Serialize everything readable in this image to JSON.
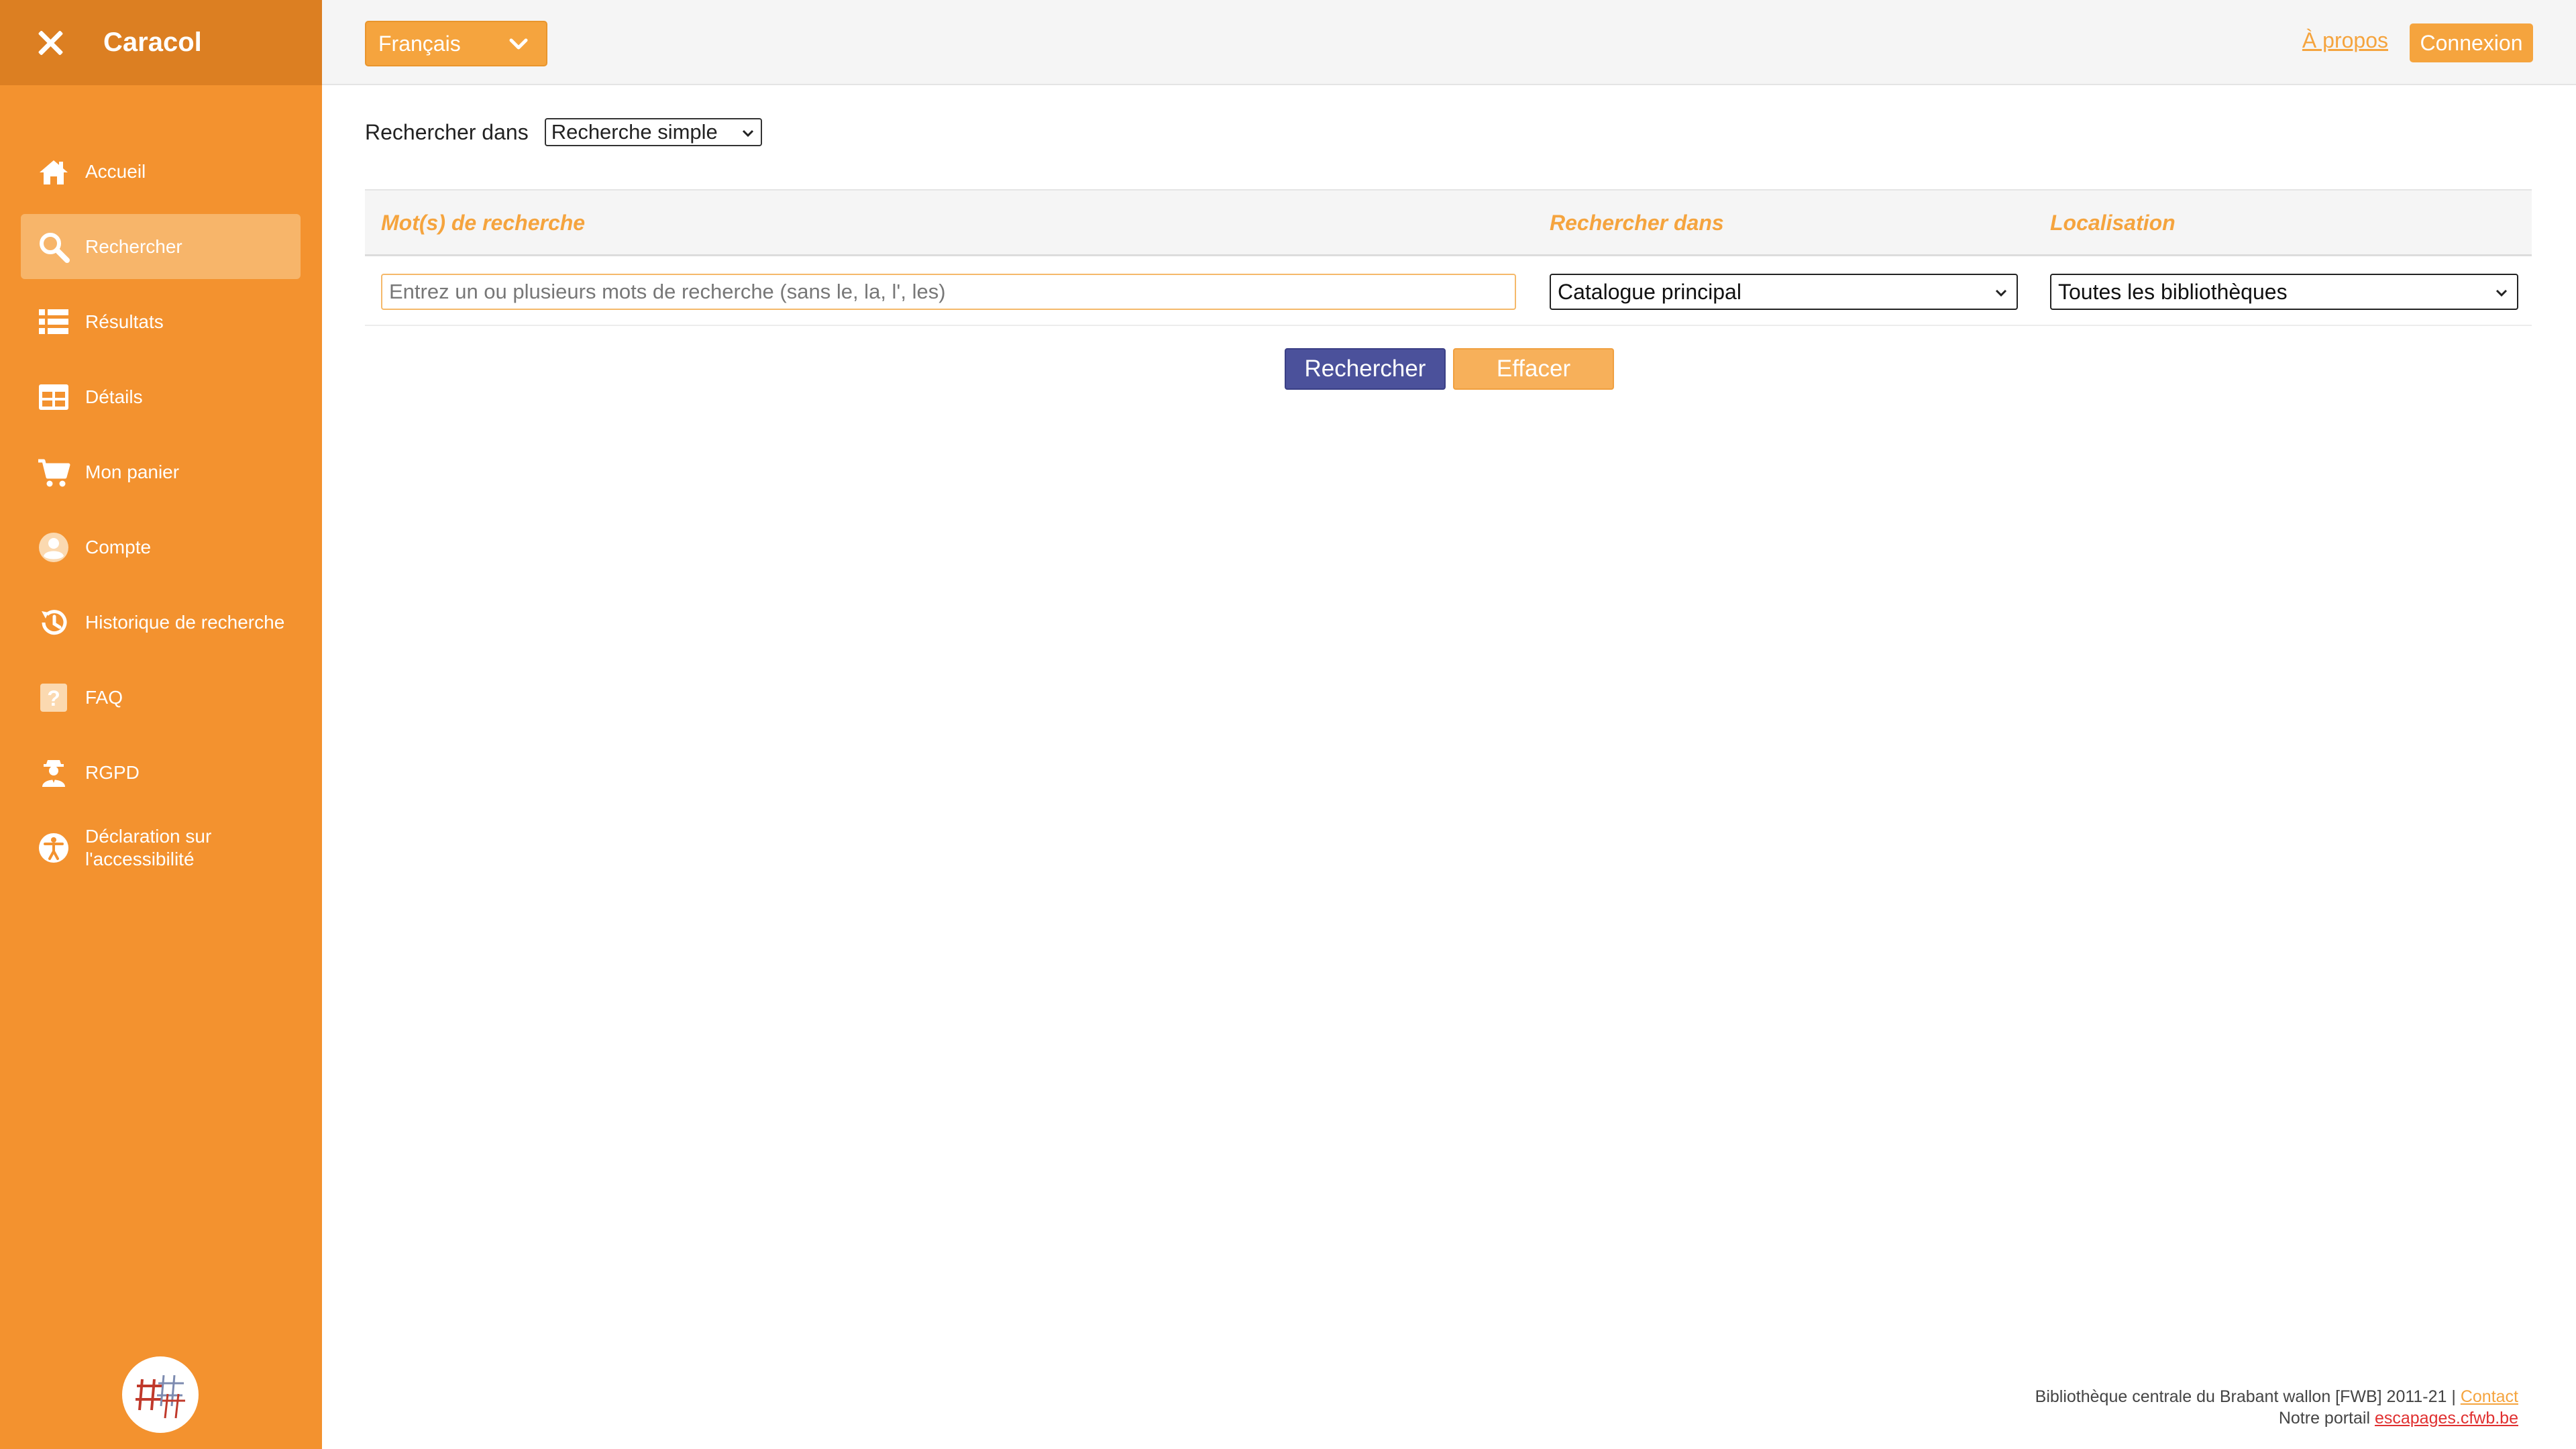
{
  "app": {
    "title": "Caracol"
  },
  "sidebar": {
    "items": [
      {
        "label": "Accueil",
        "icon": "home-icon"
      },
      {
        "label": "Rechercher",
        "icon": "search-icon",
        "active": true
      },
      {
        "label": "Résultats",
        "icon": "list-icon"
      },
      {
        "label": "Détails",
        "icon": "table-icon"
      },
      {
        "label": "Mon panier",
        "icon": "cart-icon"
      },
      {
        "label": "Compte",
        "icon": "user-icon"
      },
      {
        "label": "Historique de recherche",
        "icon": "history-icon"
      },
      {
        "label": "FAQ",
        "icon": "question-icon"
      },
      {
        "label": "RGPD",
        "icon": "privacy-agent-icon"
      },
      {
        "label": "Déclaration sur l'accessibilité",
        "icon": "accessibility-icon"
      }
    ]
  },
  "topbar": {
    "language": "Français",
    "about_link": "À propos",
    "login_button": "Connexion"
  },
  "search_mode": {
    "label": "Rechercher dans",
    "selected": "Recherche simple"
  },
  "search_table": {
    "headers": [
      "Mot(s) de recherche",
      "Rechercher dans",
      "Localisation"
    ],
    "keyword_placeholder": "Entrez un ou plusieurs mots de recherche (sans le, la, l', les)",
    "catalog_selected": "Catalogue principal",
    "location_selected": "Toutes les bibliothèques"
  },
  "actions": {
    "search_button": "Rechercher",
    "clear_button": "Effacer"
  },
  "footer": {
    "library_text": "Bibliothèque centrale du Brabant wallon [FWB] 2011-21 |",
    "contact_link": "Contact",
    "portal_text": "Notre portail",
    "portal_link": "escapages.cfwb.be"
  },
  "colors": {
    "sidebar": "#f3922f",
    "sidebar_header": "#dc7f22",
    "accent": "#f5a43e",
    "primary_button": "#4b519b"
  }
}
